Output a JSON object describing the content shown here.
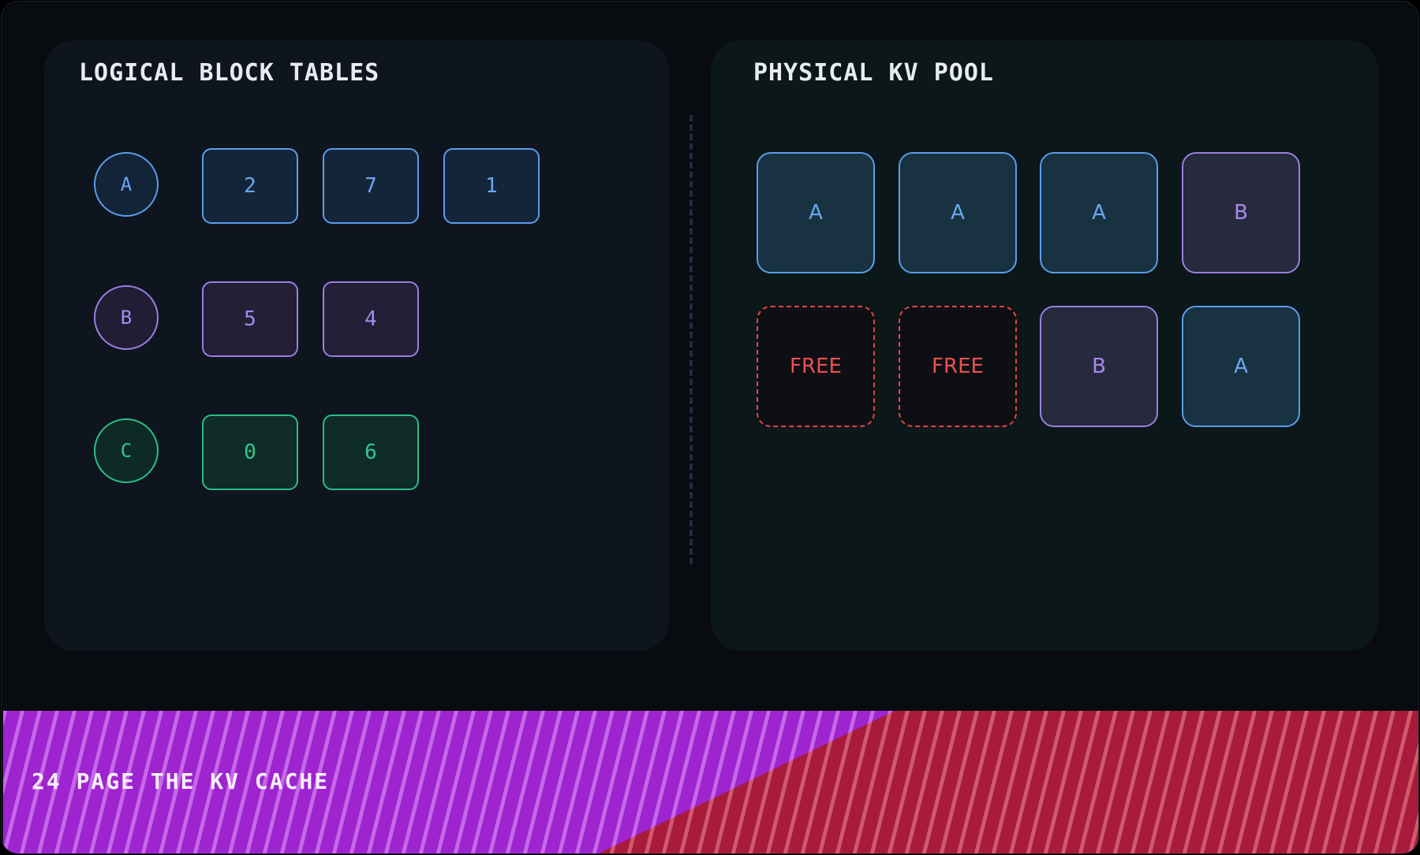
{
  "left_panel": {
    "title": "LOGICAL BLOCK TABLES",
    "sequences": [
      {
        "label": "A",
        "color": "#5b9cea",
        "blocks": [
          "2",
          "7",
          "1"
        ]
      },
      {
        "label": "B",
        "color": "#9a7fe0",
        "blocks": [
          "5",
          "4"
        ]
      },
      {
        "label": "C",
        "color": "#2bbd86",
        "blocks": [
          "0",
          "6"
        ]
      }
    ]
  },
  "right_panel": {
    "title": "PHYSICAL KV POOL",
    "slots": [
      {
        "label": "A",
        "state": "used",
        "color": "#5b9cea"
      },
      {
        "label": "A",
        "state": "used",
        "color": "#5b9cea"
      },
      {
        "label": "A",
        "state": "used",
        "color": "#5b9cea"
      },
      {
        "label": "B",
        "state": "used",
        "color": "#9a7fe0"
      },
      {
        "label": "FREE",
        "state": "free",
        "color": "#e04545"
      },
      {
        "label": "FREE",
        "state": "free",
        "color": "#e04545"
      },
      {
        "label": "B",
        "state": "used",
        "color": "#9a7fe0"
      },
      {
        "label": "A",
        "state": "used",
        "color": "#5b9cea"
      }
    ]
  },
  "footer": {
    "label": "24 PAGE THE KV CACHE",
    "colors": {
      "purple": "#9e24cf",
      "red": "#a81b3a"
    }
  }
}
